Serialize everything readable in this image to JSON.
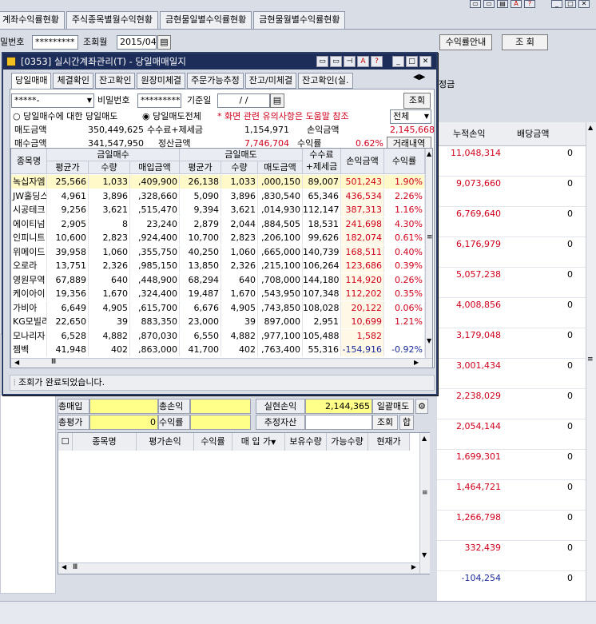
{
  "top_tabs": [
    "계좌수익률현황",
    "주식종목별월수익현황",
    "금현물일별수익률현황",
    "금현물월별수익률현황"
  ],
  "filter": {
    "account_label": "밀번호",
    "password_value": "*********",
    "month_label": "조회월",
    "month_value": "2015/04",
    "guide_button": "수익률안내",
    "search_button": "조 회"
  },
  "right_panel": {
    "partial_label": "정금",
    "headers": [
      "누적손익",
      "배당금액"
    ],
    "rows": [
      {
        "cum": "11,048,314",
        "div": "0"
      },
      {
        "cum": "9,073,660",
        "div": "0"
      },
      {
        "cum": "6,769,640",
        "div": "0"
      },
      {
        "cum": "6,176,979",
        "div": "0"
      },
      {
        "cum": "5,057,238",
        "div": "0"
      },
      {
        "cum": "4,008,856",
        "div": "0"
      },
      {
        "cum": "3,179,048",
        "div": "0"
      },
      {
        "cum": "3,001,434",
        "div": "0"
      },
      {
        "cum": "2,238,029",
        "div": "0"
      },
      {
        "cum": "2,054,144",
        "div": "0"
      },
      {
        "cum": "1,699,301",
        "div": "0"
      },
      {
        "cum": "1,464,721",
        "div": "0"
      },
      {
        "cum": "1,266,798",
        "div": "0"
      },
      {
        "cum": "332,439",
        "div": "0"
      },
      {
        "cum": "-104,254",
        "div": "0"
      }
    ]
  },
  "popup": {
    "title": "[0353] 실시간계좌관리(T) - 당일매매일지",
    "tabs": [
      "당일매매",
      "체결확인",
      "잔고확인",
      "원장미체결",
      "주문가능추정",
      "잔고/미체결",
      "잔고확인(실."
    ],
    "account_value": "*****-",
    "password_label": "비밀번호",
    "password_value": "*********",
    "base_date_label": "기준일",
    "base_date_value": "/  /",
    "search_button": "조회",
    "radio1": "당일매수에 대한 당일매도",
    "radio2": "당일매도전체",
    "notice": "* 화면 관련 유의사항은 도움말 참조",
    "filter_value": "전체",
    "summary": {
      "sell_label": "매도금액",
      "sell_value": "350,449,625",
      "fee_label": "수수료+제세금",
      "fee_value": "1,154,971",
      "pl_label": "손익금액",
      "pl_value": "2,145,668",
      "buy_label": "매수금액",
      "buy_value": "341,547,950",
      "settle_label": "정산금액",
      "settle_value": "7,746,704",
      "rate_label": "수익률",
      "rate_value": "0.62%",
      "history_button": "거래내역"
    },
    "headers": {
      "name": "종목명",
      "buy_group": "금일매수",
      "sell_group": "금일매도",
      "avg": "평균가",
      "qty": "수량",
      "buy_amt": "매입금액",
      "sell_amt": "매도금액",
      "fee": "수수료\n+제세금",
      "pl": "손익금액",
      "rate": "수익률"
    },
    "rows": [
      [
        "녹십자엠",
        "25,566",
        "1,033",
        ",409,900",
        "26,138",
        "1,033",
        ",000,150",
        "89,007",
        "501,243",
        "1.90%"
      ],
      [
        "JW홀딩스",
        "4,961",
        "3,896",
        ",328,660",
        "5,090",
        "3,896",
        ",830,540",
        "65,346",
        "436,534",
        "2.26%"
      ],
      [
        "시공테크",
        "9,256",
        "3,621",
        ",515,470",
        "9,394",
        "3,621",
        ",014,930",
        "112,147",
        "387,313",
        "1.16%"
      ],
      [
        "에이티넘",
        "2,905",
        "8",
        "23,240",
        "2,879",
        "2,044",
        ",884,505",
        "18,531",
        "241,698",
        "4.30%"
      ],
      [
        "인피니트",
        "10,600",
        "2,823",
        ",924,400",
        "10,700",
        "2,823",
        ",206,100",
        "99,626",
        "182,074",
        "0.61%"
      ],
      [
        "위메이드",
        "39,958",
        "1,060",
        ",355,750",
        "40,250",
        "1,060",
        ",665,000",
        "140,739",
        "168,511",
        "0.40%"
      ],
      [
        "오로라",
        "13,751",
        "2,326",
        ",985,150",
        "13,850",
        "2,326",
        ",215,100",
        "106,264",
        "123,686",
        "0.39%"
      ],
      [
        "영원무역",
        "67,889",
        "640",
        ",448,900",
        "68,294",
        "640",
        ",708,000",
        "144,180",
        "114,920",
        "0.26%"
      ],
      [
        "케이아이",
        "19,356",
        "1,670",
        ",324,400",
        "19,487",
        "1,670",
        ",543,950",
        "107,348",
        "112,202",
        "0.35%"
      ],
      [
        "가비아",
        "6,649",
        "4,905",
        ",615,700",
        "6,676",
        "4,905",
        ",743,850",
        "108,028",
        "20,122",
        "0.06%"
      ],
      [
        "KG모빌리",
        "22,650",
        "39",
        "883,350",
        "23,000",
        "39",
        "897,000",
        "2,951",
        "10,699",
        "1.21%"
      ],
      [
        "모나리자",
        "6,528",
        "4,882",
        ",870,030",
        "6,550",
        "4,882",
        ",977,100",
        "105,488",
        "1,582",
        ""
      ],
      [
        "젬벡",
        "41,948",
        "402",
        ",863,000",
        "41,700",
        "402",
        ",763,400",
        "55,316",
        "-154,916",
        "-0.92%"
      ]
    ],
    "status": "조회가 완료되었습니다."
  },
  "lower": {
    "total_buy_label": "총매입",
    "total_profit_label": "총손익",
    "realized_label": "실현손익",
    "realized_value": "2,144,365",
    "bulk_sell_button": "일괄매도",
    "total_eval_label": "총평가",
    "total_eval_value": "0",
    "rate_label": "수익률",
    "est_asset_label": "추정자산",
    "search_button": "조회",
    "sum_button": "합",
    "headers": [
      "종목명",
      "평가손익",
      "수익률",
      "매 입 가",
      "보유수량",
      "가능수량",
      "현재가"
    ]
  }
}
